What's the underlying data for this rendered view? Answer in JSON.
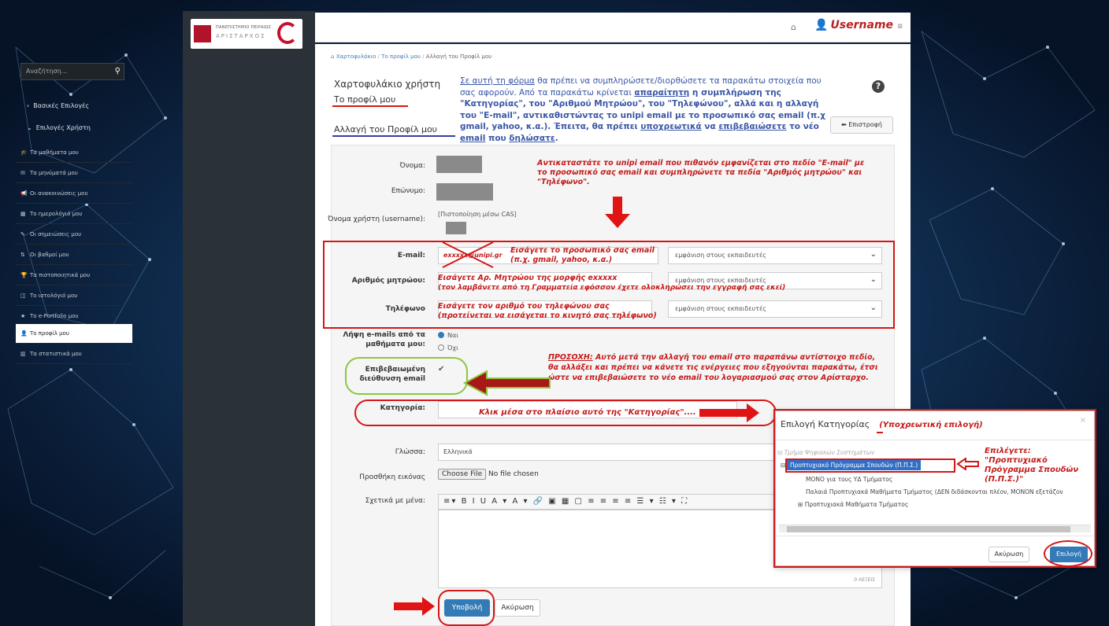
{
  "app": {
    "logo_line1": "ΠΑΝΕΠΙΣΤΗΜΙΟ ΠΕΙΡΑΙΩΣ",
    "logo_line2": "ΑΡΙΣΤΑΡΧΟΣ",
    "username": "Username"
  },
  "sidebar": {
    "search_placeholder": "Αναζήτηση...",
    "section_basic": "Βασικές Επιλογές",
    "section_user": "Επιλογές Χρήστη",
    "items": [
      {
        "label": "Τα μαθήματα μου",
        "icon": "graduation-cap-icon"
      },
      {
        "label": "Τα μηνύματά μου",
        "icon": "envelope-icon"
      },
      {
        "label": "Οι ανακοινώσεις μου",
        "icon": "bullhorn-icon"
      },
      {
        "label": "Το ημερολόγιό μου",
        "icon": "calendar-icon"
      },
      {
        "label": "Οι σημειώσεις μου",
        "icon": "edit-icon"
      },
      {
        "label": "Οι βαθμοί μου",
        "icon": "sort-icon"
      },
      {
        "label": "Τα πιστοποιητικά μου",
        "icon": "trophy-icon"
      },
      {
        "label": "Το ιστολόγιό μου",
        "icon": "columns-icon"
      },
      {
        "label": "Το e-Portfolio μου",
        "icon": "star-icon"
      },
      {
        "label": "Το προφίλ μου",
        "icon": "user-icon"
      },
      {
        "label": "Τα στατιστικά μου",
        "icon": "chart-icon"
      }
    ]
  },
  "breadcrumb": {
    "home": "Χαρτοφυλάκιο",
    "profile": "Το προφίλ μου",
    "current": "Αλλαγή του Προφίλ μου",
    "sep": "/"
  },
  "header": {
    "title": "Χαρτοφυλάκιο χρήστη",
    "subtitle": "Το προφίλ μου",
    "page_title": "Αλλαγή του Προφίλ μου",
    "back_button": "Επιστροφή"
  },
  "intro": {
    "p1a": "Σε αυτή τη φόρμα",
    "p1b": " θα πρέπει να συμπληρώσετε/διορθώσετε τα παρακάτω στοιχεία που σας αφορούν. Από τα παρακάτω κρίνεται ",
    "p1c": "απαραίτητη",
    "p1d": " η συμπλήρωση της \"Κατηγορίας\", του \"Αριθμού Μητρώου\", του \"Τηλεφώνου\", αλλά και η αλλαγή του \"E-mail\", αντικαθιστώντας το unipi email με το προσωπικό σας email (π.χ gmail, yahoo, κ.α.). Έπειτα, θα πρέπει ",
    "p1e": "υποχρεωτικά",
    "p1f": " να ",
    "p1g": "επιβεβαιώσετε",
    "p1h": " το νέο ",
    "p1i": "email",
    "p1j": " που ",
    "p1k": "δηλώσατε",
    "p1l": "."
  },
  "form": {
    "name_label": "Όνομα:",
    "surname_label": "Επώνυμο:",
    "username_label": "Όνομα χρήστη (username):",
    "username_value": "[Πιστοποίηση μέσω CAS]",
    "email_label": "E-mail:",
    "email_value": "exxxxx@unipi.gr",
    "am_label": "Αριθμός μητρώου:",
    "phone_label": "Τηλέφωνο",
    "visibility_option": "εμφάνιση στους εκπαιδευτές",
    "receive_label": "Λήψη e-mails από τα μαθήματα μου:",
    "radio_yes": "Ναι",
    "radio_no": "Όχι",
    "verified_label": "Επιβεβαιωμένη διεύθυνση email",
    "verified_mark": "✔",
    "category_label": "Κατηγορία:",
    "language_label": "Γλώσσα:",
    "language_value": "Ελληνικά",
    "image_label": "Προσθήκη εικόνας",
    "choose_file": "Choose File",
    "no_file": "No file chosen",
    "about_label": "Σχετικά με μένα:",
    "toolbar_glyphs": "≡▾ B I U A ▾ A ▾ 🔗 ▣ ▦ ▢ ≡ ≡ ≡ ≡ ☰ ▾ ☷ ▾ ⛶",
    "words": "0 ΛΕΞΕΙΣ",
    "submit": "Υποβολή",
    "cancel": "Ακύρωση"
  },
  "annotations": {
    "replace_email": "Αντικαταστάτε το unipi email που πιθανόν εμφανίζεται στο πεδίο \"E-mail\" με το προσωπικό σας email και συμπληρώνετε τα πεδία \"Αριθμός μητρώου\" και \"Τηλέφωνο\".",
    "email_hint1": "Εισάγετε το προσωπικό σας email",
    "email_hint2": "(π.χ. gmail, yahoo, κ.α.)",
    "am_hint1": "Εισάγετε Αρ. Μητρώου της μορφής exxxxx",
    "am_hint2": "(τον λαμβάνετε από τη Γραμματεία εφόσσον έχετε ολοκληρώσει την εγγραφή σας εκεί)",
    "phone_hint1": "Εισάγετε τον αριθμό του τηλεφώνου σας",
    "phone_hint2": "(προτείνεται να εισάγεται το κινητό σας τηλέφωνο)",
    "attention_lead": "ΠΡΟΣΟΧΗ:",
    "attention_body": " Αυτό μετά την αλλαγή του email στο παραπάνω αντίστοιχο πεδίο, θα αλλάξει και πρέπει να κάνετε τις ενέργειες που εξηγούνται παρακάτω, έτσι ώστε να επιβεβαιώσετε το νέο email του λογαριασμού σας στον Αρίσταρχο.",
    "click_category": "Κλικ μέσα στο πλαίσιο αυτό της \"Κατηγορίας\"....",
    "choose_hint": "Επιλέγετε: \"Προπτυχιακό Πρόγραμμα Σπουδών (Π.Π.Σ.)\""
  },
  "modal": {
    "title": "Επιλογή Κατηγορίας",
    "required": "(Υποχρεωτική επιλογή)",
    "close": "×",
    "tree_root": "Τμήμα Ψηφιακών Συστημάτων",
    "tree_selected": "Προπτυχιακό Πρόγραμμα Σπουδών (Π.Π.Σ.)",
    "tree_child1": "ΜΟΝΟ για τους ΥΔ Τμήματος",
    "tree_child2": "Παλαιά Προπτυχιακά Μαθήματα Τμήματος (ΔΕΝ διδάσκονται πλέον, ΜΟΝΟΝ εξετάζον",
    "tree_child3": "Προπτυχιακά Μαθήματα Τμήματος",
    "cancel": "Ακύρωση",
    "select": "Επιλογή"
  },
  "colors": {
    "accent": "#337ab7",
    "annotation_red": "#c41a1a",
    "sidebar_bg": "#2b3138",
    "background": "#081a35"
  }
}
